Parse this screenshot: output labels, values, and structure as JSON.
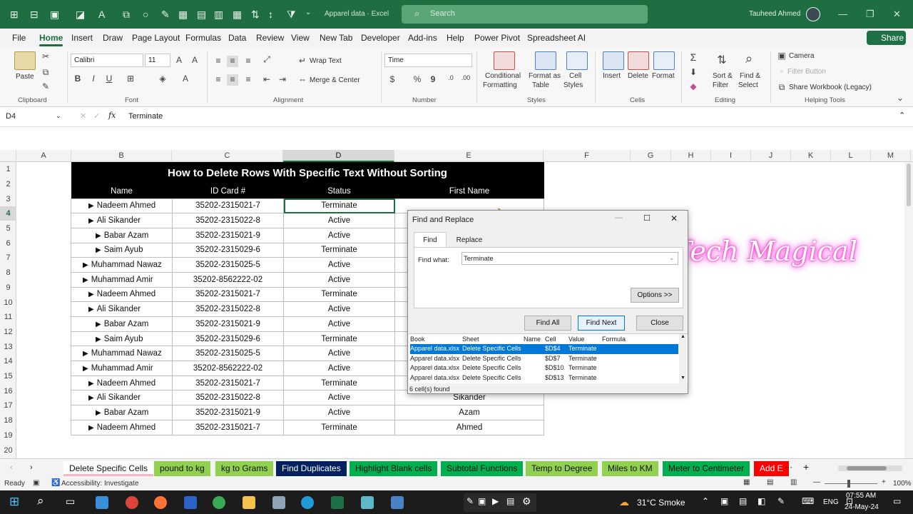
{
  "titlebar": {
    "doc": "Apparel data  ·  Excel",
    "search": "Search",
    "user": "Tauheed Ahmed"
  },
  "menu": [
    "File",
    "Home",
    "Insert",
    "Draw",
    "Page Layout",
    "Formulas",
    "Data",
    "Review",
    "View",
    "New Tab",
    "Developer",
    "Add-ins",
    "Help",
    "Power Pivot",
    "Spreadsheet AI"
  ],
  "share": "Share",
  "ribbon": {
    "paste": "Paste",
    "clipboard": "Clipboard",
    "font_name": "Calibri",
    "font_size": "11",
    "font": "Font",
    "wrap_text": "Wrap Text",
    "merge_center": "Merge & Center",
    "alignment": "Alignment",
    "number_format": "Time",
    "number": "Number",
    "conditional": [
      "Conditional",
      "Formatting"
    ],
    "format_table": [
      "Format as",
      "Table"
    ],
    "cell_styles": [
      "Cell",
      "Styles"
    ],
    "styles": "Styles",
    "insert": "Insert",
    "delete": "Delete",
    "format": "Format",
    "cells": "Cells",
    "sort_filter": [
      "Sort &",
      "Filter"
    ],
    "find_select": [
      "Find &",
      "Select"
    ],
    "editing": "Editing",
    "camera": "Camera",
    "filter_button": "Filter Button",
    "share_workbook": "Share Workbook (Legacy)",
    "helping_tools": "Helping Tools"
  },
  "formula": {
    "namebox": "D4",
    "fx": "fx",
    "value": "Terminate"
  },
  "columns": [
    "A",
    "B",
    "C",
    "D",
    "E",
    "F",
    "G",
    "H",
    "I",
    "J",
    "K",
    "L",
    "M"
  ],
  "rows": [
    "1",
    "2",
    "3",
    "4",
    "5",
    "6",
    "7",
    "8",
    "9",
    "10",
    "11",
    "12",
    "13",
    "14",
    "15",
    "16",
    "17",
    "18",
    "19",
    "20"
  ],
  "table": {
    "title": "How to Delete Rows With Specific Text Without Sorting",
    "headers": [
      "Name",
      "ID Card #",
      "Status",
      "First Name"
    ],
    "rows": [
      [
        "Nadeem Ahmed",
        "35202-2315021-7",
        "Terminate",
        ""
      ],
      [
        "Ali Sikander",
        "35202-2315022-8",
        "Active",
        ""
      ],
      [
        "Babar Azam",
        "35202-2315021-9",
        "Active",
        ""
      ],
      [
        "Saim Ayub",
        "35202-2315029-6",
        "Terminate",
        ""
      ],
      [
        "Muhammad Nawaz",
        "35202-2315025-5",
        "Active",
        ""
      ],
      [
        "Muhammad Amir",
        "35202-8562222-02",
        "Active",
        ""
      ],
      [
        "Nadeem Ahmed",
        "35202-2315021-7",
        "Terminate",
        ""
      ],
      [
        "Ali Sikander",
        "35202-2315022-8",
        "Active",
        ""
      ],
      [
        "Babar Azam",
        "35202-2315021-9",
        "Active",
        ""
      ],
      [
        "Saim Ayub",
        "35202-2315029-6",
        "Terminate",
        ""
      ],
      [
        "Muhammad Nawaz",
        "35202-2315025-5",
        "Active",
        ""
      ],
      [
        "Muhammad Amir",
        "35202-8562222-02",
        "Active",
        ""
      ],
      [
        "Nadeem Ahmed",
        "35202-2315021-7",
        "Terminate",
        ""
      ],
      [
        "Ali Sikander",
        "35202-2315022-8",
        "Active",
        "Sikander"
      ],
      [
        "Babar Azam",
        "35202-2315021-9",
        "Active",
        "Azam"
      ],
      [
        "Nadeem Ahmed",
        "35202-2315021-7",
        "Terminate",
        "Ahmed"
      ]
    ]
  },
  "dialog": {
    "title": "Find and Replace",
    "tab_find": "Find",
    "tab_replace": "Replace",
    "find_what_label": "Find what:",
    "find_what_value": "Terminate",
    "options": "Options >>",
    "find_all": "Find All",
    "find_next": "Find Next",
    "close": "Close",
    "result_headers": [
      "Book",
      "Sheet",
      "Name",
      "Cell",
      "Value",
      "Formula"
    ],
    "results": [
      [
        "Apparel data.xlsx",
        "Delete Specific Cells",
        "",
        "$D$4",
        "Terminate"
      ],
      [
        "Apparel data.xlsx",
        "Delete Specific Cells",
        "",
        "$D$7",
        "Terminate"
      ],
      [
        "Apparel data.xlsx",
        "Delete Specific Cells",
        "",
        "$D$10",
        "Terminate"
      ],
      [
        "Apparel data.xlsx",
        "Delete Specific Cells",
        "",
        "$D$13",
        "Terminate"
      ]
    ],
    "status": "6 cell(s) found"
  },
  "watermark": "Tech Magical",
  "sheets": [
    {
      "label": "Delete Specific Cells",
      "color": "#f4b6c2"
    },
    {
      "label": "pound to kg",
      "color": "#92d050"
    },
    {
      "label": "kg to Grams",
      "color": "#92d050"
    },
    {
      "label": "Find Duplicates",
      "color": "#002060"
    },
    {
      "label": "Highlight Blank cells",
      "color": "#00b050"
    },
    {
      "label": "Subtotal Functions",
      "color": "#00b050"
    },
    {
      "label": "Temp to Degree",
      "color": "#92d050"
    },
    {
      "label": "Miles to KM",
      "color": "#92d050"
    },
    {
      "label": "Meter to Centimeter",
      "color": "#00b050"
    },
    {
      "label": "Add E",
      "color": "#ff0000"
    }
  ],
  "statusbar": {
    "ready": "Ready",
    "accessibility": "Accessibility: Investigate",
    "zoom": "100%"
  },
  "taskbar": {
    "weather": "31°C  Smoke",
    "lang": "ENG",
    "time": "07:55 AM",
    "date": "24-May-24"
  }
}
